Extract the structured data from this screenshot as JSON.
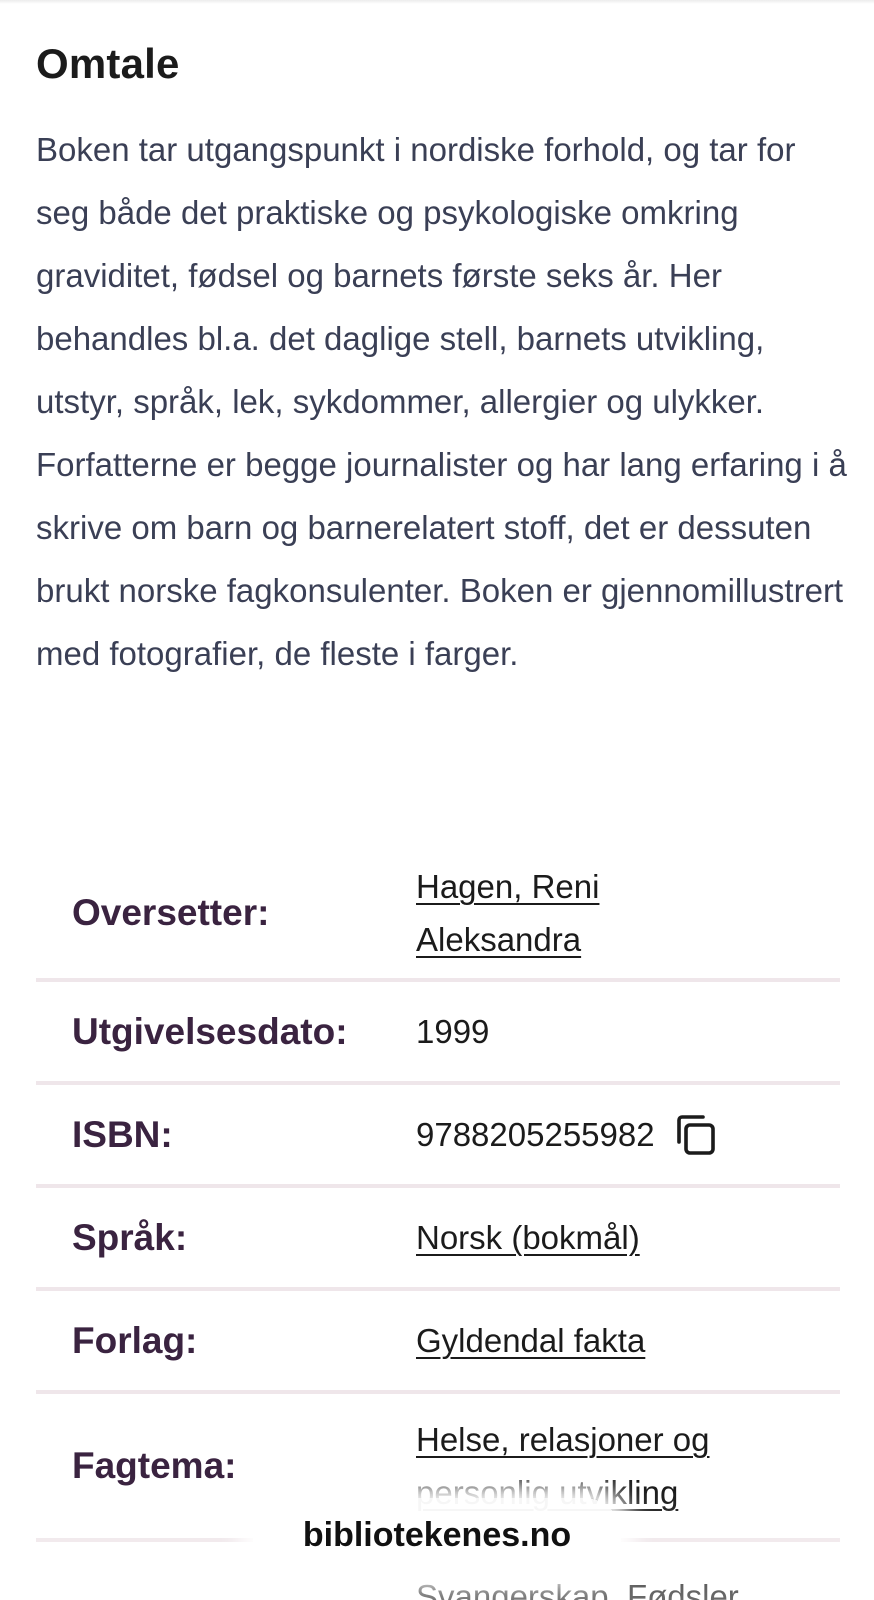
{
  "section": {
    "title": "Omtale",
    "description": "Boken tar utgangspunkt i nordiske forhold, og tar for seg både det praktiske og psykologiske omkring graviditet, fødsel og barnets første seks år. Her behandles bl.a. det daglige stell, barnets utvikling, utstyr, språk, lek, sykdommer, allergier og ulykker. Forfatterne er begge journalister og har lang erfaring i å skrive om barn og barnerelatert stoff, det er dessuten brukt norske fagkonsulenter. Boken er gjennomillustrert med fotografier, de fleste i farger."
  },
  "details": {
    "translator": {
      "label": "Oversetter:",
      "line1": "Hagen, Reni",
      "line2": "Aleksandra"
    },
    "release_date": {
      "label": "Utgivelsesdato:",
      "value": "1999"
    },
    "isbn": {
      "label": "ISBN:",
      "value": "9788205255982",
      "icon": "copy-icon"
    },
    "language": {
      "label": "Språk:",
      "value": "Norsk (bokmål)"
    },
    "publisher": {
      "label": "Forlag:",
      "value": "Gyldendal fakta"
    },
    "topic": {
      "label": "Fagtema:",
      "line1": "Helse, relasjoner og",
      "line2": "personlig utvikling"
    },
    "topic_next": {
      "value": "Svangerskap, Fødsler"
    }
  },
  "footer": {
    "site": "bibliotekenes.no"
  },
  "colors": {
    "label": "#3a2340",
    "body_text": "#3a3f55",
    "divider": "#efe6ea"
  }
}
